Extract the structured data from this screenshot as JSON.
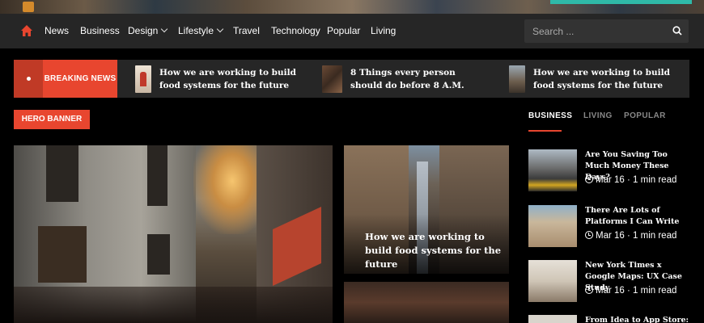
{
  "nav": {
    "home_icon": "home-icon",
    "items": [
      {
        "label": "News",
        "has_dropdown": false
      },
      {
        "label": "Business",
        "has_dropdown": false
      },
      {
        "label": "Design",
        "has_dropdown": true
      },
      {
        "label": "Lifestyle",
        "has_dropdown": true
      },
      {
        "label": "Travel",
        "has_dropdown": false
      },
      {
        "label": "Technology",
        "has_dropdown": false
      },
      {
        "label": "Popular",
        "has_dropdown": false
      },
      {
        "label": "Living",
        "has_dropdown": false
      }
    ],
    "search_placeholder": "Search ..."
  },
  "breaking": {
    "label": "BREAKING NEWS",
    "items": [
      {
        "title": "How we are working to build food systems for the future"
      },
      {
        "title": "8 Things every person should do before 8 A.M."
      },
      {
        "title": "How we are working to build food systems for the future"
      }
    ]
  },
  "hero": {
    "label": "HERO BANNER",
    "side_article_title": "How we are working to build food systems for the future"
  },
  "sidebar": {
    "tabs": [
      "BUSINESS",
      "LIVING",
      "POPULAR"
    ],
    "active_tab": "BUSINESS",
    "articles": [
      {
        "title": "Are You Saving Too Much Money These Days?",
        "date": "Mar 16",
        "read_time": "1 min read"
      },
      {
        "title": "There Are Lots of Platforms I Can Write",
        "date": "Mar 16",
        "read_time": "1 min read"
      },
      {
        "title": "New York Times x Google Maps: UX Case Study",
        "date": "Mar 16",
        "read_time": "1 min read"
      },
      {
        "title": "From Idea to App Store: A",
        "date": "",
        "read_time": ""
      }
    ]
  },
  "colors": {
    "accent": "#e8462f",
    "nav_bg": "#262626",
    "page_bg": "#000000"
  }
}
